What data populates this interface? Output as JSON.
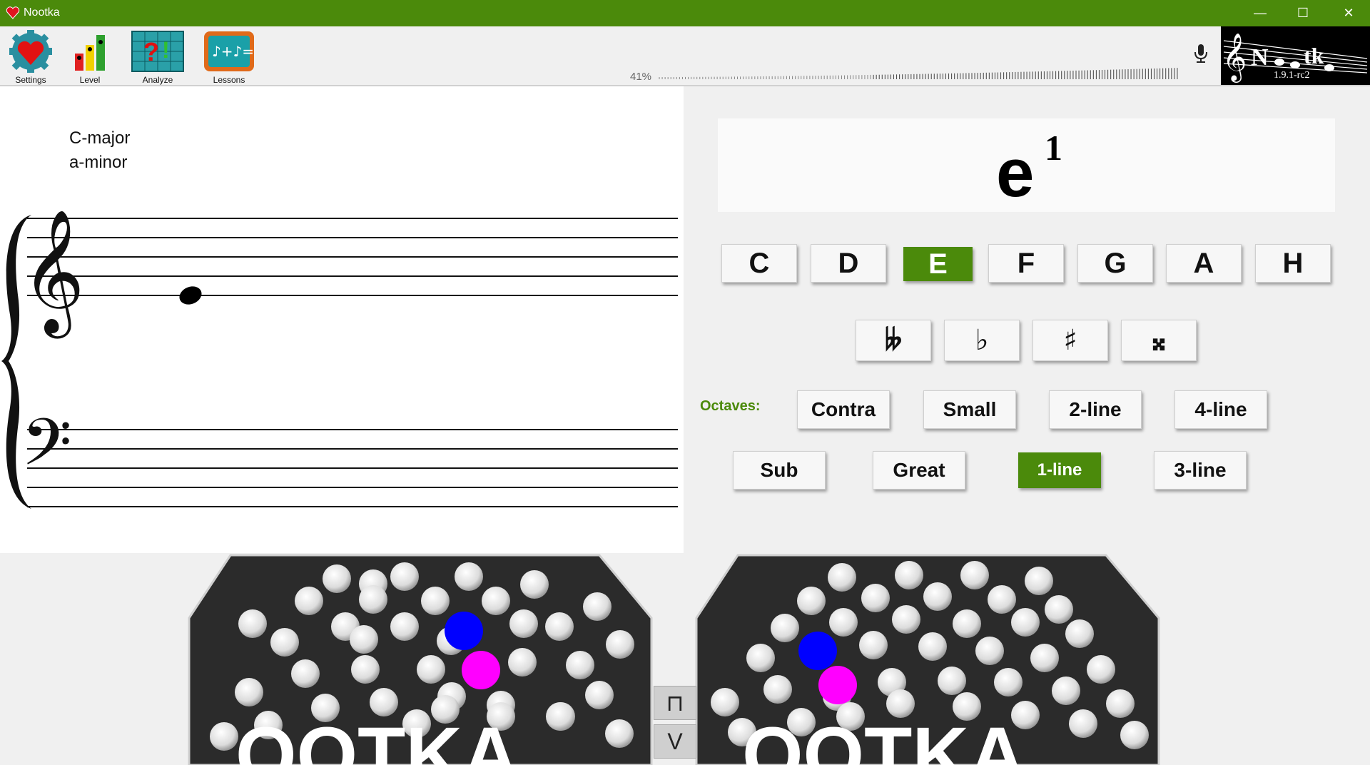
{
  "app": {
    "title": "Nootka"
  },
  "window": {
    "minimize": "—",
    "maximize": "☐",
    "close": "✕"
  },
  "toolbar": {
    "settings_label": "Settings",
    "level_label": "Level",
    "analyze_label": "Analyze",
    "lessons_label": "Lessons"
  },
  "pitch": {
    "volume_percent": "41%",
    "volume_level": 0.41
  },
  "logo": {
    "version": "1.9.1-rc2"
  },
  "score": {
    "key_major": "C-major",
    "key_minor": "a-minor"
  },
  "note_display": {
    "name": "e",
    "octave_mark": "1"
  },
  "notes": [
    "C",
    "D",
    "E",
    "F",
    "G",
    "A",
    "H"
  ],
  "selected_note": "E",
  "accidentals": [
    "𝄫",
    "♭",
    "♯",
    "𝄪"
  ],
  "octaves_label": "Octaves:",
  "octaves_row1": [
    "Contra",
    "Small",
    "2-line",
    "4-line"
  ],
  "octaves_row2": [
    "Sub",
    "Great",
    "1-line",
    "3-line"
  ],
  "selected_octave": "1-line",
  "bandoneon": {
    "body_color": "#2b2b2b",
    "key_color": "#e8e8e8",
    "highlight_open": "#0000ff",
    "highlight_close": "#ff00ff",
    "bellows_open": "⊓",
    "bellows_close": "V"
  }
}
